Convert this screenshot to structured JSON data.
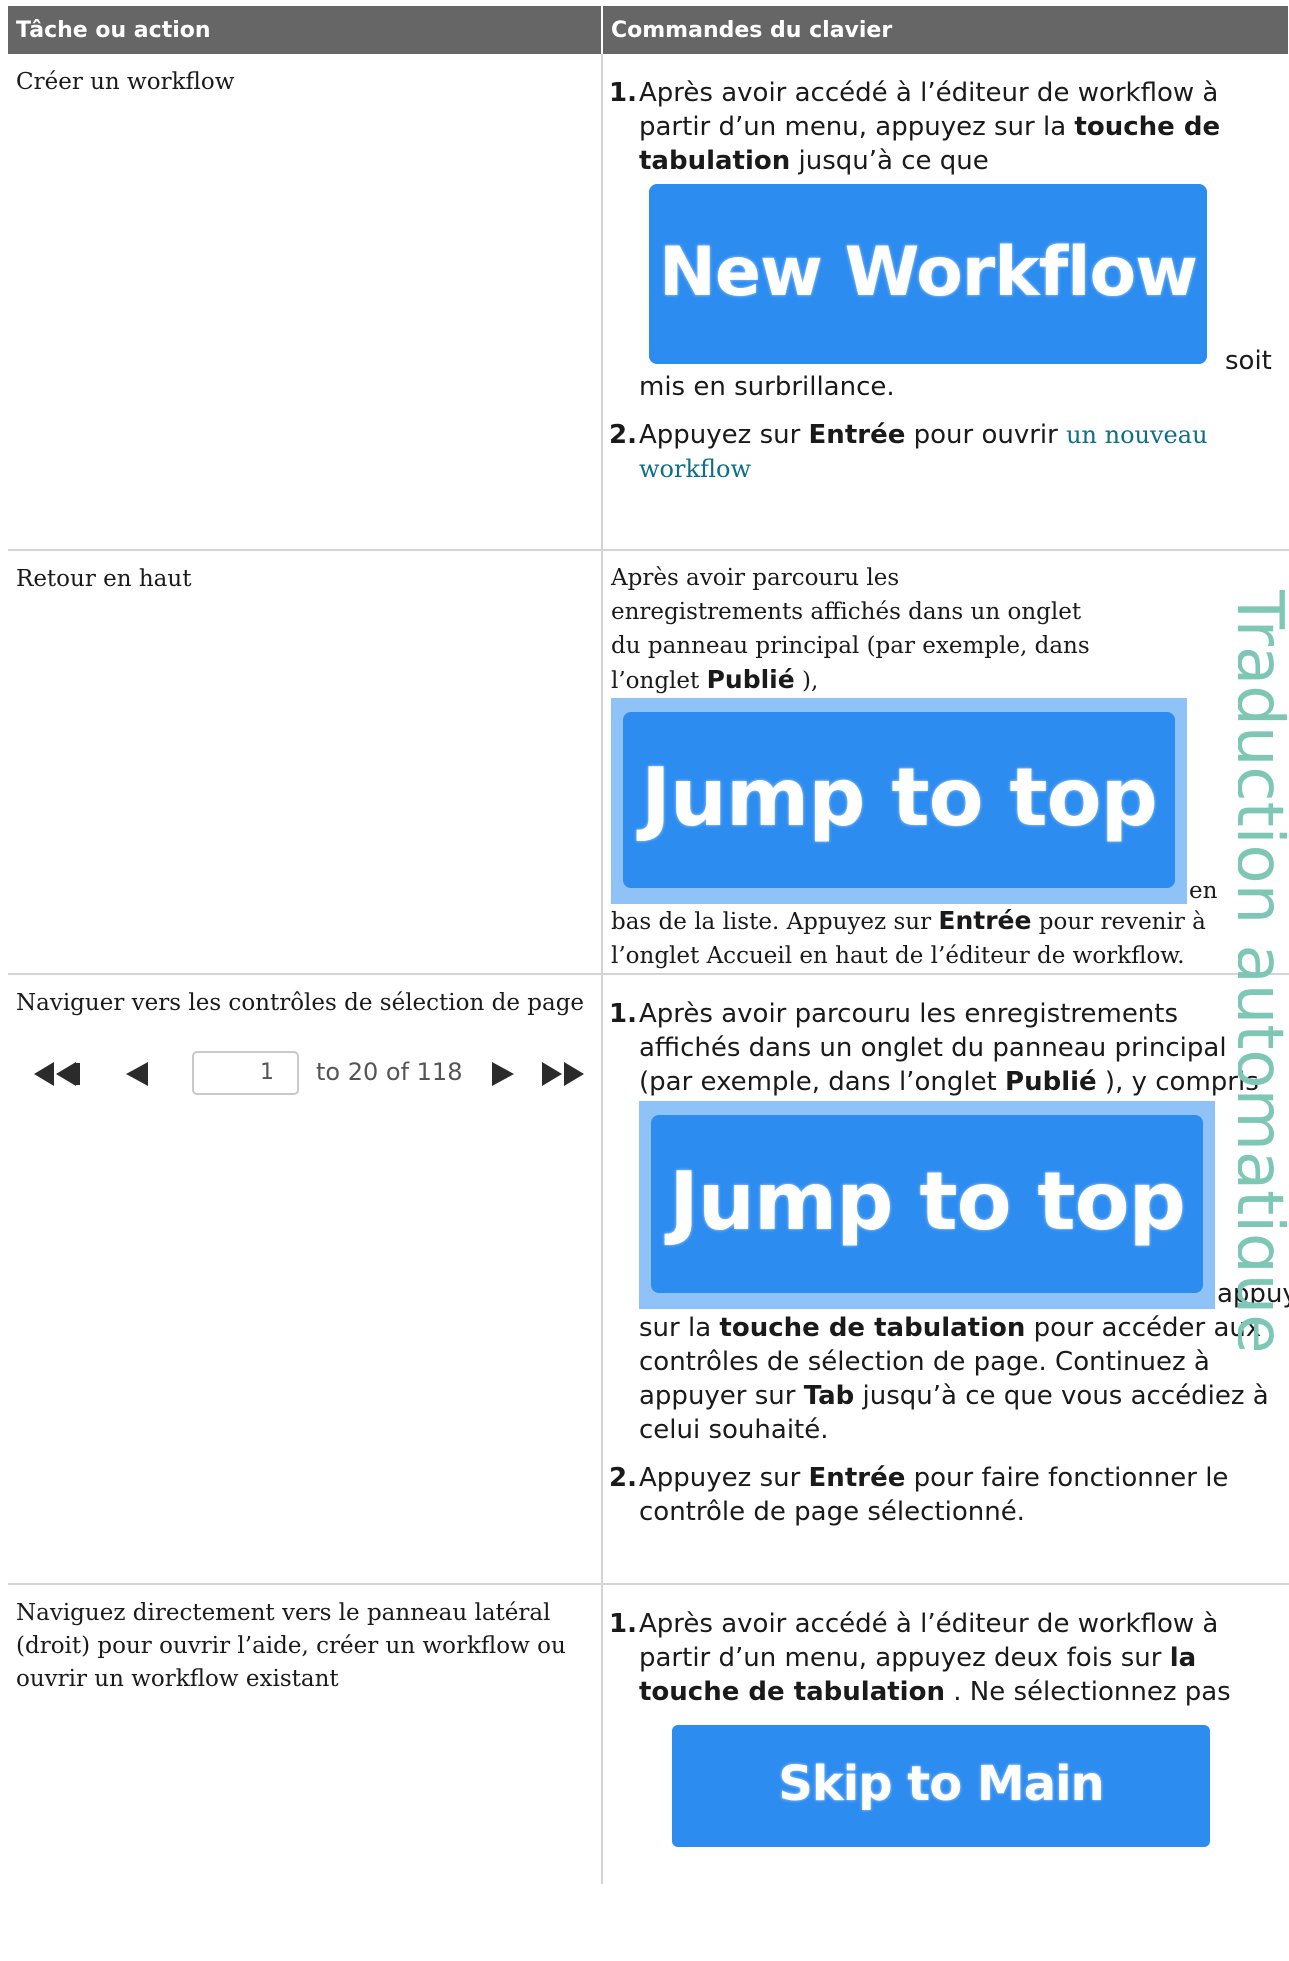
{
  "header": {
    "col_task": "Tâche ou action",
    "col_keys": "Commandes du clavier"
  },
  "watermark": "Traduction automatique",
  "rows": [
    {
      "task": "Créer un workflow",
      "step1_a": "Après avoir accédé à l’éditeur de workflow à partir d’un menu, appuyez sur la ",
      "step1_bold": "touche de tabulation",
      "step1_b": " jusqu’à ce que",
      "button": "New Workflow",
      "step1_c": "soit",
      "step1_d": "mis en surbrillance.",
      "step2_a": "Appuyez sur ",
      "step2_bold": "Entrée",
      "step2_b": " pour ouvrir ",
      "step2_link": "un nouveau workflow"
    },
    {
      "task": "Retour en haut",
      "text_a": "Après avoir parcouru les enregistrements affichés dans un onglet du panneau principal (par exemple, dans l’onglet ",
      "text_bold": "Publié",
      "text_b": " ),",
      "button": "Jump to top",
      "text_c": "en",
      "text_d": "bas de la liste. Appuyez sur ",
      "text_bold2": "Entrée",
      "text_e": " pour revenir à l’onglet Accueil en haut de l’éditeur de workflow."
    },
    {
      "task": "Naviguer vers les contrôles de sélection de page",
      "pager": {
        "page": "1",
        "range": "to 20 of 118"
      },
      "step1_a": "Après avoir parcouru les enregistrements affichés dans un onglet du panneau principal (par exemple, dans l’onglet ",
      "step1_bold": "Publié",
      "step1_b": " ), y compris",
      "button": "Jump to top",
      "step1_c": "appuy",
      "step1_d1": "sur la ",
      "step1_bold2": "touche de tabulation",
      "step1_d2": " pour accéder aux contrôles de sélection de page. Continuez à appuyer sur ",
      "step1_bold3": "Tab",
      "step1_d3": " jusqu’à ce que vous accédiez à celui souhaité.",
      "step2_a": "Appuyez sur ",
      "step2_bold": "Entrée",
      "step2_b": " pour faire fonctionner le contrôle de page sélectionné."
    },
    {
      "task": "Naviguez directement vers le panneau latéral (droit) pour ouvrir l’aide, créer un workflow ou ouvrir un workflow existant",
      "step1_a": "Après avoir accédé à l’éditeur de workflow à partir d’un menu, appuyez deux fois sur ",
      "step1_bold": "la touche de tabulation",
      "step1_b": " . Ne sélectionnez pas",
      "button": "Skip to Main Content"
    }
  ]
}
